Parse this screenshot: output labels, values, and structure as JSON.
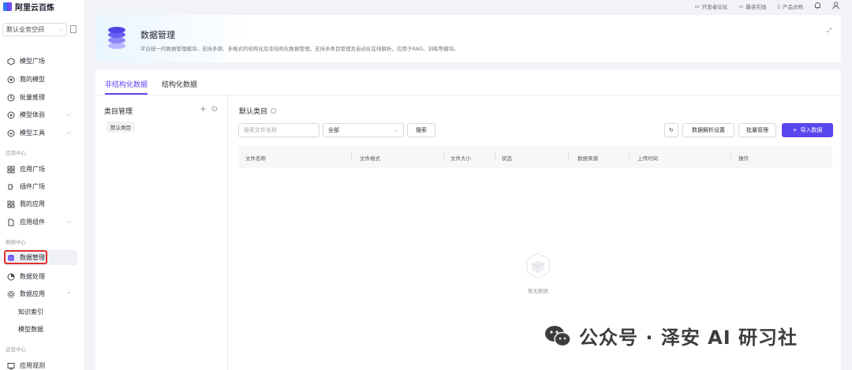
{
  "app": {
    "name": "阿里云百炼"
  },
  "workspace": {
    "label": "默认业务空间"
  },
  "topbar": {
    "items": [
      "开发者论坛",
      "最佳实践",
      "产品文档"
    ]
  },
  "sidebar": {
    "items_top": [
      {
        "label": "模型广场",
        "icon": "cube-icon"
      },
      {
        "label": "我的模型",
        "icon": "model-icon"
      },
      {
        "label": "批量推理",
        "icon": "batch-icon"
      },
      {
        "label": "模型体验",
        "icon": "experience-icon",
        "chevron": "down"
      },
      {
        "label": "模型工具",
        "icon": "tool-icon",
        "chevron": "down"
      }
    ],
    "group_app": "应用中心",
    "items_app": [
      {
        "label": "应用广场",
        "icon": "grid-icon"
      },
      {
        "label": "插件广场",
        "icon": "plugin-icon"
      },
      {
        "label": "我的应用",
        "icon": "apps-icon"
      },
      {
        "label": "应用组件",
        "icon": "component-icon",
        "chevron": "down"
      }
    ],
    "group_data": "数据中心",
    "items_data": [
      {
        "label": "数据管理",
        "icon": "database-icon",
        "active": true
      },
      {
        "label": "数据处理",
        "icon": "process-icon"
      },
      {
        "label": "数据应用",
        "icon": "gear-icon",
        "chevron": "up"
      }
    ],
    "items_data_sub": [
      {
        "label": "知识索引"
      },
      {
        "label": "模型数据"
      }
    ],
    "group_ops": "运营中心",
    "items_ops": [
      {
        "label": "应用观测",
        "icon": "monitor-icon"
      }
    ]
  },
  "header": {
    "title": "数据管理",
    "description": "平台统一的数据管理模块，支持多源、多格式的结构化及非结构化数据管理，支持多类目管理及自动化在线解析，应用于RAG、训练等模块。"
  },
  "tabs": [
    {
      "label": "非结构化数据",
      "active": true
    },
    {
      "label": "结构化数据",
      "active": false
    }
  ],
  "category": {
    "title": "类目管理",
    "items": [
      "默认类目"
    ]
  },
  "content": {
    "title": "默认类目",
    "search_placeholder": "搜索文件名称",
    "filter_value": "全部",
    "search_button": "搜索",
    "parse_settings": "数据解析设置",
    "batch_manage": "批量管理",
    "import_data": "导入数据",
    "columns": [
      "文件名称",
      "文件格式",
      "文件大小",
      "状态",
      "数据来源",
      "上传时间",
      "操作"
    ],
    "empty_text": "暂无数据"
  },
  "watermark": {
    "text": "公众号 · 泽安 AI 研习社"
  },
  "colors": {
    "accent": "#5b47f0",
    "active_outline": "#e0312f"
  }
}
